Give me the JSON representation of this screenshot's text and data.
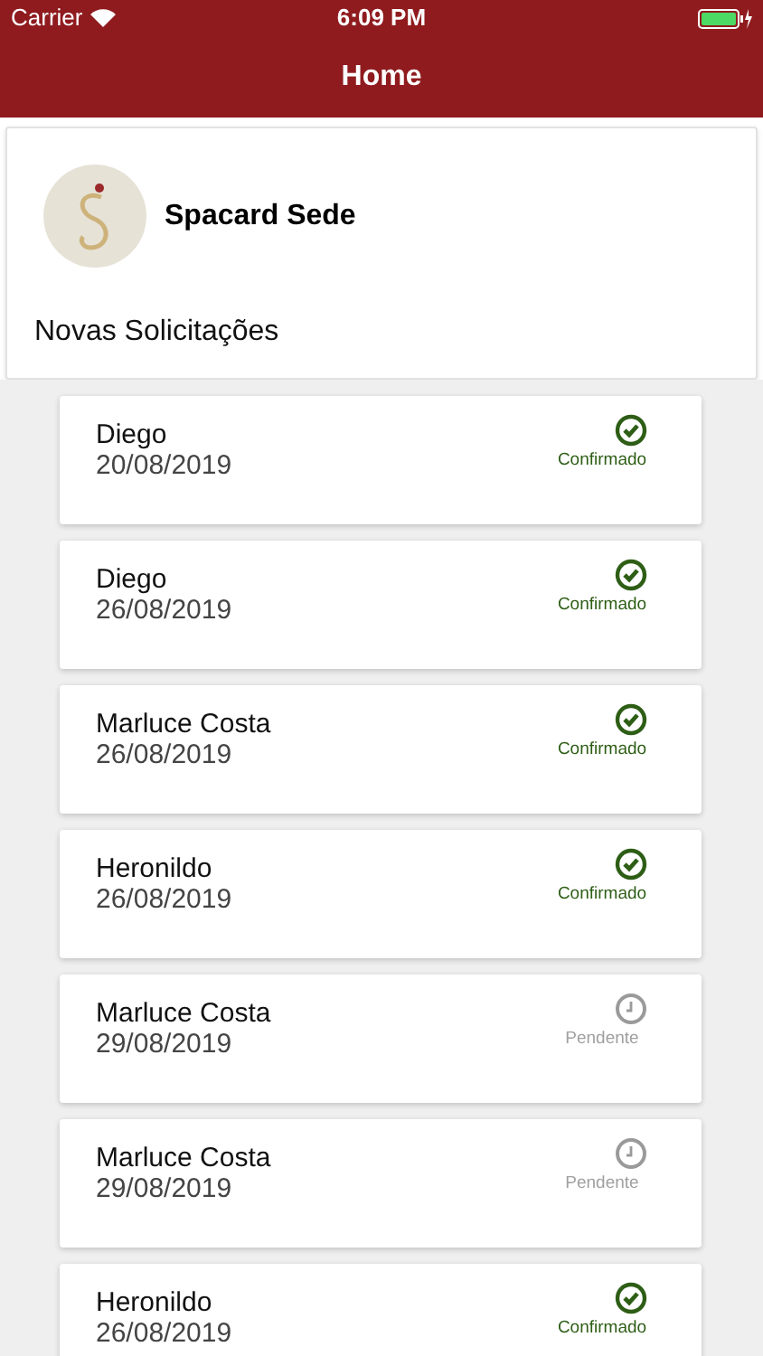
{
  "status_bar": {
    "carrier": "Carrier",
    "time": "6:09 PM"
  },
  "nav": {
    "title": "Home"
  },
  "header": {
    "name": "Spacard Sede",
    "section": "Novas Solicitações"
  },
  "requests": [
    {
      "name": "Diego",
      "date": "20/08/2019",
      "confirmed": true,
      "label": "Confirmado"
    },
    {
      "name": "Diego",
      "date": "26/08/2019",
      "confirmed": true,
      "label": "Confirmado"
    },
    {
      "name": "Marluce Costa",
      "date": "26/08/2019",
      "confirmed": true,
      "label": "Confirmado"
    },
    {
      "name": "Heronildo",
      "date": "26/08/2019",
      "confirmed": true,
      "label": "Confirmado"
    },
    {
      "name": "Marluce Costa",
      "date": "29/08/2019",
      "confirmed": false,
      "label": "Pendente"
    },
    {
      "name": "Marluce Costa",
      "date": "29/08/2019",
      "confirmed": false,
      "label": "Pendente"
    },
    {
      "name": "Heronildo",
      "date": "26/08/2019",
      "confirmed": true,
      "label": "Confirmado"
    }
  ]
}
